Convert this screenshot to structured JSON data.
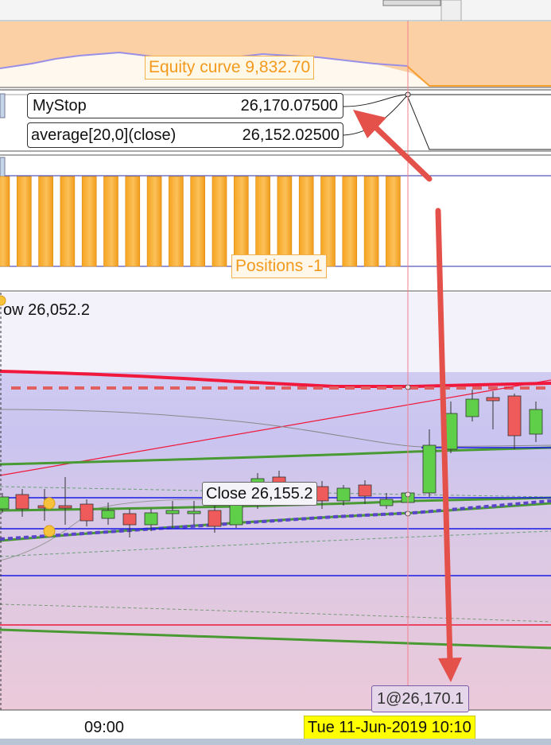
{
  "panels": {
    "equity": {
      "label": "Equity curve",
      "value": "9,832.70"
    },
    "indicators": [
      {
        "name": "MyStop",
        "value": "26,170.07500"
      },
      {
        "name": "average[20,0](close)",
        "value": "26,152.02500"
      }
    ],
    "positions": {
      "label": "Positions",
      "value": "-1"
    },
    "price": {
      "low_label": "ow 26,052.2",
      "close_label": "Close",
      "close_value": "26,155.2",
      "order_marker": "1@26,170.1"
    }
  },
  "axis": {
    "time_label": "09:00",
    "cursor_date": "Tue 11-Jun-2019 10:10"
  },
  "colors": {
    "equity_fill": "#fbd0a4",
    "equity_line": "#9a8fe6",
    "equity_line_after": "#f5a030",
    "position_bar": "#f7a41f",
    "bull_candle": "#5fcf4a",
    "bear_candle": "#ef5b5b",
    "upper_band": "#f0183c",
    "mystop_dash": "#e06060",
    "ma_green": "#4a9a34",
    "ma_dotted": "#5a45c8",
    "support_blue": "#1a1ae6",
    "arrow": "#e4504a",
    "cursor_line": "#f27f8f"
  },
  "chart_data": {
    "type": "candlestick",
    "x": [
      "09:00",
      "Tue 11-Jun-2019 10:10"
    ],
    "indicators": {
      "MyStop": 26170.075,
      "average_20_close": 26152.025,
      "close": 26155.2,
      "low": 26052.2,
      "equity_curve": 9832.7,
      "positions": -1
    },
    "order": "1@26,170.1"
  }
}
